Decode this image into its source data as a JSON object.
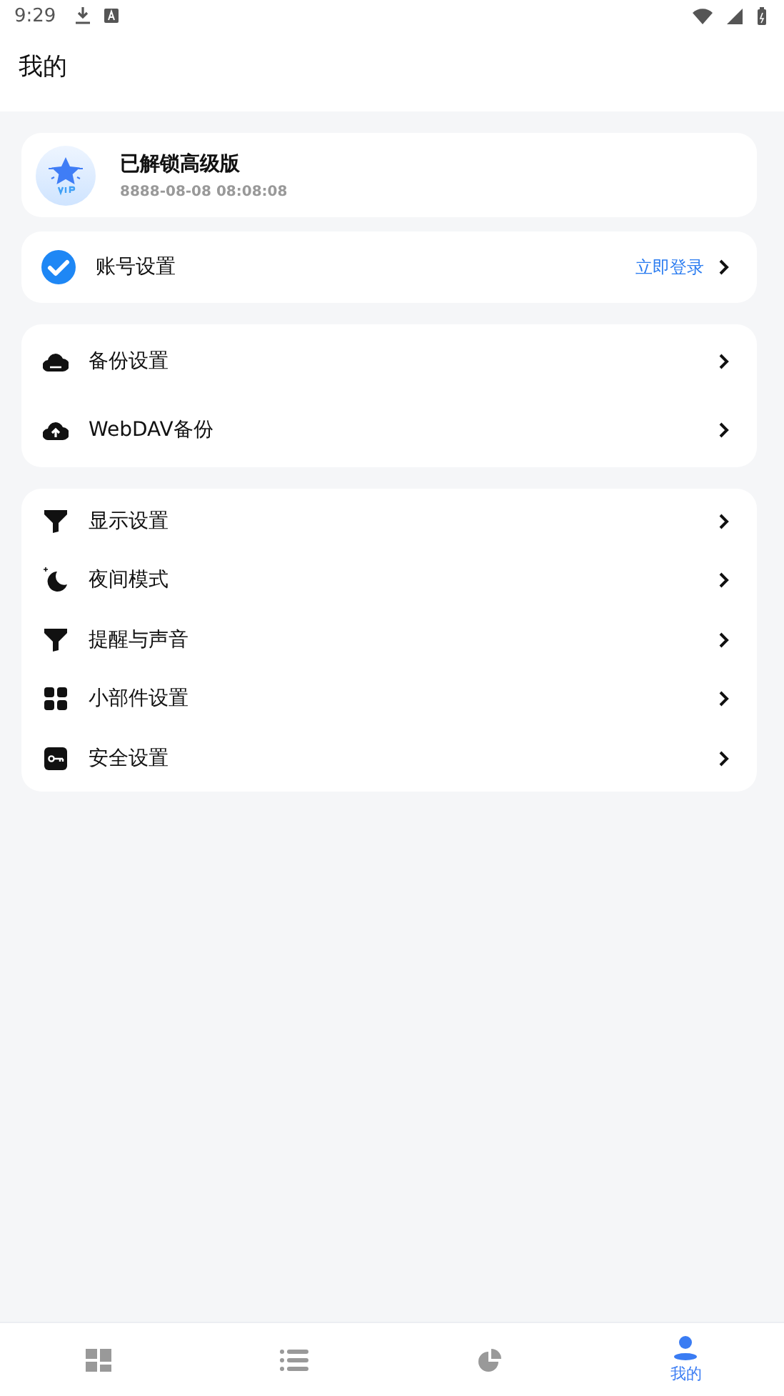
{
  "status_bar": {
    "time": "9:29"
  },
  "header": {
    "title": "我的"
  },
  "vip_card": {
    "title": "已解锁高级版",
    "date": "8888-08-08 08:08:08"
  },
  "account": {
    "label": "账号设置",
    "action": "立即登录"
  },
  "groups": [
    {
      "items": [
        {
          "kind": "cloud",
          "label": "备份设置"
        },
        {
          "kind": "upload",
          "label": "WebDAV备份"
        }
      ]
    },
    {
      "items": [
        {
          "kind": "funnel",
          "label": "显示设置"
        },
        {
          "kind": "moon",
          "label": "夜间模式"
        },
        {
          "kind": "funnel",
          "label": "提醒与声音"
        },
        {
          "kind": "grid",
          "label": "小部件设置"
        },
        {
          "kind": "key",
          "label": "安全设置"
        }
      ]
    }
  ],
  "bottom_nav": [
    {
      "kind": "dashboard",
      "selected": false
    },
    {
      "kind": "list",
      "selected": false
    },
    {
      "kind": "pie",
      "selected": false
    },
    {
      "kind": "person",
      "selected": true,
      "label": "我的"
    }
  ]
}
